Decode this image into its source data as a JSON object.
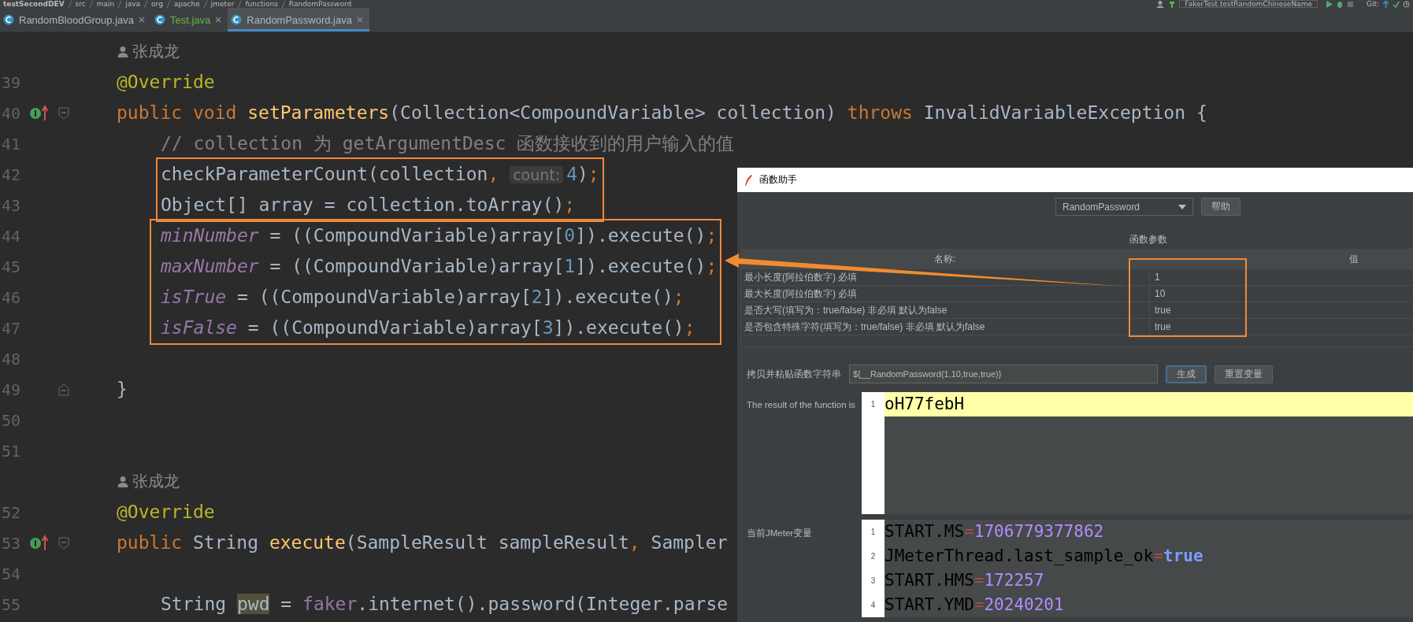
{
  "breadcrumb": [
    "testSecondDEV",
    "src",
    "main",
    "java",
    "org",
    "apache",
    "jmeter",
    "functions",
    "RandomPassword"
  ],
  "toolbar": {
    "run_config": "FakerTest.testRandomChineseName",
    "vcs_label": "Git:"
  },
  "tabs": [
    {
      "label": "RandomBloodGroup.java",
      "selected": false,
      "color": "#a9b7c6"
    },
    {
      "label": "Test.java",
      "selected": false,
      "color": "#62b543"
    },
    {
      "label": "RandomPassword.java",
      "selected": true,
      "color": "#a9b7c6"
    }
  ],
  "code_lines": [
    {
      "kind": "author",
      "text": "张成龙"
    },
    {
      "kind": "code",
      "number": "39",
      "tokens": [
        {
          "text": "@Override",
          "kind": "annotation"
        }
      ]
    },
    {
      "kind": "code",
      "number": "40",
      "gutter_icon": true,
      "fold_start": true,
      "tokens": [
        {
          "text": "public ",
          "kind": "keyword"
        },
        {
          "text": "void ",
          "kind": "keyword"
        },
        {
          "text": "setParameters",
          "kind": "method"
        },
        {
          "text": "(Collection<CompoundVariable> collection) ",
          "kind": "plain"
        },
        {
          "text": "throws ",
          "kind": "keyword"
        },
        {
          "text": "InvalidVariableException {",
          "kind": "plain"
        }
      ]
    },
    {
      "kind": "code",
      "number": "41",
      "indented": true,
      "tokens": [
        {
          "text": "// collection 为 getArgumentDesc 函数接收到的用户输入的值",
          "kind": "comment"
        }
      ]
    },
    {
      "kind": "code",
      "number": "42",
      "indented": true,
      "boxed": true,
      "box_start": true,
      "tokens": [
        {
          "text": "checkParameterCount(collection",
          "kind": "plain"
        },
        {
          "text": ", ",
          "kind": "punct"
        },
        {
          "text": "count:",
          "kind": "hint"
        },
        {
          "text": "4",
          "kind": "number"
        },
        {
          "text": ")",
          "kind": "plain"
        },
        {
          "text": ";",
          "kind": "punct"
        }
      ]
    },
    {
      "kind": "code",
      "number": "43",
      "indented": true,
      "boxed": true,
      "tokens": [
        {
          "text": "Object[] array = collection.toArray()",
          "kind": "plain"
        },
        {
          "text": ";",
          "kind": "punct"
        }
      ]
    },
    {
      "kind": "code",
      "number": "44",
      "indented": true,
      "boxed": true,
      "box_start": true,
      "tokens": [
        {
          "text": "minNumber",
          "kind": "static"
        },
        {
          "text": " = ((CompoundVariable)array[",
          "kind": "plain"
        },
        {
          "text": "0",
          "kind": "number"
        },
        {
          "text": "]).execute()",
          "kind": "plain"
        },
        {
          "text": ";",
          "kind": "punct"
        }
      ]
    },
    {
      "kind": "code",
      "number": "45",
      "indented": true,
      "boxed": true,
      "tokens": [
        {
          "text": "maxNumber",
          "kind": "static"
        },
        {
          "text": " = ((CompoundVariable)array[",
          "kind": "plain"
        },
        {
          "text": "1",
          "kind": "number"
        },
        {
          "text": "]).execute()",
          "kind": "plain"
        },
        {
          "text": ";",
          "kind": "punct"
        }
      ]
    },
    {
      "kind": "code",
      "number": "46",
      "indented": true,
      "boxed": true,
      "tokens": [
        {
          "text": "isTrue",
          "kind": "static"
        },
        {
          "text": " = ((CompoundVariable)array[",
          "kind": "plain"
        },
        {
          "text": "2",
          "kind": "number"
        },
        {
          "text": "]).execute()",
          "kind": "plain"
        },
        {
          "text": ";",
          "kind": "punct"
        }
      ]
    },
    {
      "kind": "code",
      "number": "47",
      "indented": true,
      "boxed": true,
      "tokens": [
        {
          "text": "isFalse",
          "kind": "static"
        },
        {
          "text": " = ((CompoundVariable)array[",
          "kind": "plain"
        },
        {
          "text": "3",
          "kind": "number"
        },
        {
          "text": "]).execute()",
          "kind": "plain"
        },
        {
          "text": ";",
          "kind": "punct"
        }
      ]
    },
    {
      "kind": "code",
      "number": "48"
    },
    {
      "kind": "code",
      "number": "49",
      "fold_end": true,
      "tokens": [
        {
          "text": "}",
          "kind": "plain"
        }
      ]
    },
    {
      "kind": "code",
      "number": "50"
    },
    {
      "kind": "code",
      "number": "51"
    },
    {
      "kind": "author",
      "text": "张成龙"
    },
    {
      "kind": "code",
      "number": "52",
      "tokens": [
        {
          "text": "@Override",
          "kind": "annotation"
        }
      ]
    },
    {
      "kind": "code",
      "number": "53",
      "gutter_icon": true,
      "fold_start": true,
      "tokens": [
        {
          "text": "public ",
          "kind": "keyword"
        },
        {
          "text": "String ",
          "kind": "plain"
        },
        {
          "text": "execute",
          "kind": "method"
        },
        {
          "text": "(SampleResult sampleResult",
          "kind": "plain"
        },
        {
          "text": ", ",
          "kind": "punct"
        },
        {
          "text": "Sampler",
          "kind": "plain"
        }
      ]
    },
    {
      "kind": "code",
      "number": "54"
    },
    {
      "kind": "code",
      "number": "55",
      "indented": true,
      "tokens": [
        {
          "text": "String ",
          "kind": "plain"
        },
        {
          "text": "pwd",
          "kind": "usage"
        },
        {
          "text": " = ",
          "kind": "plain"
        },
        {
          "text": "faker",
          "kind": "field"
        },
        {
          "text": ".internet().password(Integer.parse",
          "kind": "plain"
        }
      ]
    }
  ],
  "dialog": {
    "title": "函数助手",
    "function_select": "RandomPassword",
    "help_button": "帮助",
    "params_title": "函数参数",
    "columns": [
      "名称:",
      "值"
    ],
    "params": [
      {
        "name": "最小长度(阿拉伯数字) 必填",
        "value": "1"
      },
      {
        "name": "最大长度(阿拉伯数字) 必填",
        "value": "10"
      },
      {
        "name": "是否大写(填写为：true/false) 非必填 默认为false",
        "value": "true"
      },
      {
        "name": "是否包含特殊字符(填写为：true/false) 非必填 默认为false",
        "value": "true"
      }
    ],
    "value_box": true,
    "arrow_to_code": true,
    "copy_label": "拷贝并粘贴函数字符串",
    "function_string": "${__RandomPassword(1,10,true,true)}",
    "generate_button": {
      "label": "生成",
      "focused": true
    },
    "reset_button": "重置变量",
    "result": {
      "label": "The result of the function is",
      "lines": [
        {
          "number": "1",
          "highlighted": true,
          "tokens": [
            {
              "text": "oH77febH",
              "kind": "plain"
            }
          ]
        }
      ]
    },
    "variables": {
      "label": "当前JMeter变量",
      "lines": [
        {
          "number": "1",
          "highlighted": false,
          "tokens": [
            {
              "text": "START.MS",
              "kind": "plain"
            },
            {
              "text": "=",
              "kind": "operator"
            },
            {
              "text": "1706779377862",
              "kind": "number"
            }
          ]
        },
        {
          "number": "2",
          "highlighted": false,
          "tokens": [
            {
              "text": "JMeterThread.last_sample_ok",
              "kind": "plain"
            },
            {
              "text": "=",
              "kind": "operator"
            },
            {
              "text": "true",
              "kind": "boolean"
            }
          ]
        },
        {
          "number": "3",
          "highlighted": false,
          "tokens": [
            {
              "text": "START.HMS",
              "kind": "plain"
            },
            {
              "text": "=",
              "kind": "operator"
            },
            {
              "text": "172257",
              "kind": "number"
            }
          ]
        },
        {
          "number": "4",
          "highlighted": false,
          "tokens": [
            {
              "text": "START.YMD",
              "kind": "plain"
            },
            {
              "text": "=",
              "kind": "operator"
            },
            {
              "text": "20240201",
              "kind": "number"
            }
          ]
        }
      ]
    }
  }
}
